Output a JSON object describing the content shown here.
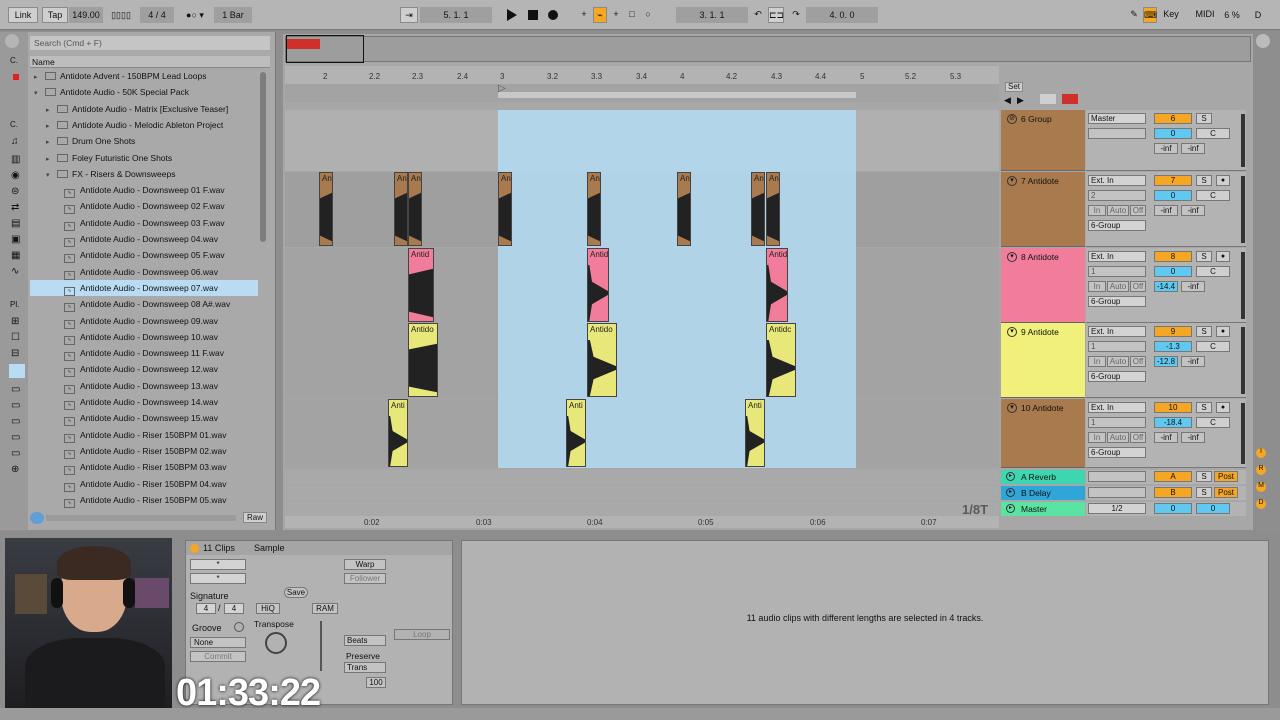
{
  "topbar": {
    "link": "Link",
    "tap": "Tap",
    "tempo": "149.00",
    "signature": "4 / 4",
    "quantize": "1 Bar",
    "position": "5.   1.   1",
    "loop_start": "3.   1.   1",
    "loop_length": "4.   0.   0",
    "key": "Key",
    "midi": "MIDI",
    "cpu": "6 %",
    "d": "D"
  },
  "browser": {
    "search_placeholder": "Search (Cmd + F)",
    "name_header": "Name",
    "items": [
      "Antidote Advent - 150BPM Lead Loops",
      "Antidote Audio - 50K Special Pack",
      "Antidote Audio - Matrix [Exclusive Teaser]",
      "Antidote Audio - Melodic Ableton Project",
      "Drum One Shots",
      "Foley Futuristic One Shots",
      "FX - Risers & Downsweeps",
      "Antidote Audio - Downsweep 01 F.wav",
      "Antidote Audio - Downsweep 02 F.wav",
      "Antidote Audio - Downsweep 03 F.wav",
      "Antidote Audio - Downsweep 04.wav",
      "Antidote Audio - Downsweep 05 F.wav",
      "Antidote Audio - Downsweep 06.wav",
      "Antidote Audio - Downsweep 07.wav",
      "Antidote Audio - Downsweep 08 A#.wav",
      "Antidote Audio - Downsweep 09.wav",
      "Antidote Audio - Downsweep 10.wav",
      "Antidote Audio - Downsweep 11 F.wav",
      "Antidote Audio - Downsweep 12.wav",
      "Antidote Audio - Downsweep 13.wav",
      "Antidote Audio - Downsweep 14.wav",
      "Antidote Audio - Downsweep 15.wav",
      "Antidote Audio - Riser 150BPM 01.wav",
      "Antidote Audio - Riser 150BPM 02.wav",
      "Antidote Audio - Riser 150BPM 03.wav",
      "Antidote Audio - Riser 150BPM 04.wav",
      "Antidote Audio - Riser 150BPM 05.wav"
    ],
    "raw": "Raw",
    "strip_labels": [
      "C.",
      "C.",
      "Pl."
    ]
  },
  "ruler": {
    "bars": [
      "2",
      "2.2",
      "2.3",
      "2.4",
      "3",
      "3.2",
      "3.3",
      "3.4",
      "4",
      "4.2",
      "4.3",
      "4.4",
      "5",
      "5.2",
      "5.3"
    ],
    "time": [
      "0:02",
      "0:03",
      "0:04",
      "0:05",
      "0:06",
      "0:07"
    ],
    "set": "Set",
    "grid": "1/8T"
  },
  "tracks": [
    {
      "name": "6 Group",
      "input": "Master",
      "vol": "6",
      "pan": "0",
      "s": "S",
      "c": "C",
      "inf1": "-inf",
      "inf2": "-inf",
      "color": "#a87a4d"
    },
    {
      "name": "7 Antidote",
      "input": "Ext. In",
      "ch": "2",
      "vol": "7",
      "pan": "0",
      "s": "S",
      "c": "C",
      "inf1": "-inf",
      "inf2": "-inf",
      "out": "6-Group",
      "color": "#a87a4d"
    },
    {
      "name": "8 Antidote",
      "input": "Ext. In",
      "ch": "1",
      "vol": "8",
      "pan": "0",
      "s": "S",
      "c": "C",
      "inf1": "-14.4",
      "inf2": "-inf",
      "out": "6-Group",
      "color": "#f27d9b"
    },
    {
      "name": "9 Antidote",
      "input": "Ext. In",
      "ch": "1",
      "vol": "9",
      "pan": "-1.3",
      "s": "S",
      "c": "C",
      "inf1": "-12.8",
      "inf2": "-inf",
      "out": "6-Group",
      "color": "#f0f07a"
    },
    {
      "name": "10 Antidote",
      "input": "Ext. In",
      "ch": "1",
      "vol": "10",
      "pan": "-18.4",
      "s": "S",
      "c": "C",
      "inf1": "-inf",
      "inf2": "-inf",
      "out": "6-Group",
      "color": "#a87a4d"
    }
  ],
  "monitor": {
    "in": "In",
    "auto": "Auto",
    "off": "Off"
  },
  "returns": [
    {
      "name": "A Reverb",
      "letter": "A",
      "s": "S",
      "post": "Post",
      "color": "#3ed6b0"
    },
    {
      "name": "B Delay",
      "letter": "B",
      "s": "S",
      "post": "Post",
      "color": "#2fa5d8"
    },
    {
      "name": "Master",
      "letter": "0",
      "out": "1/2",
      "pan": "0",
      "color": "#5be3a3"
    }
  ],
  "clips": {
    "brown": "An",
    "pink": "Antid",
    "yellow": "Antido",
    "yellow2": "Antidc",
    "yellow_small": "Anti"
  },
  "clipview": {
    "title": "11 Clips",
    "sample": "Sample",
    "star": "*",
    "signature_label": "Signature",
    "sig_num": "4",
    "sig_den": "4",
    "groove": "Groove",
    "none": "None",
    "commit": "Commit",
    "save": "Save",
    "hiq": "HiQ",
    "ram": "RAM",
    "transpose": "Transpose",
    "warp": "Warp",
    "follower": "Follower",
    "beats": "Beats",
    "preserve": "Preserve",
    "trans": "Trans",
    "val100": "100",
    "loop": "Loop"
  },
  "detail": {
    "message": "11 audio clips with different lengths are selected in 4 tracks."
  },
  "timer": "01:33:22"
}
